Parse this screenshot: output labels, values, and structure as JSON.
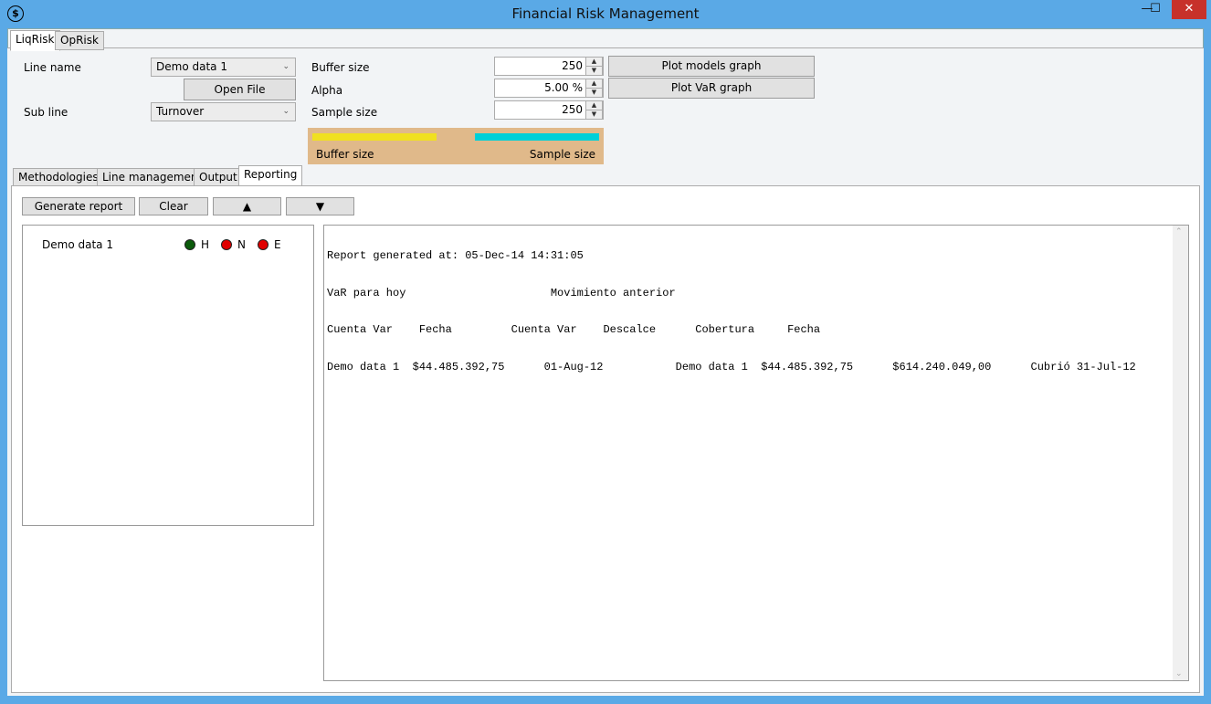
{
  "window": {
    "title": "Financial Risk Management",
    "min": "—",
    "max": "☐",
    "close": "✕",
    "app_icon": "dollar-icon",
    "app_icon_glyph": "$"
  },
  "top_tabs": [
    {
      "label": "LiqRisk"
    },
    {
      "label": "OpRisk"
    }
  ],
  "form": {
    "line_name_label": "Line name",
    "line_name_value": "Demo data 1",
    "open_file": "Open File",
    "sub_line_label": "Sub line",
    "sub_line_value": "Turnover",
    "buffer_size_label": "Buffer size",
    "buffer_size_value": "250",
    "alpha_label": "Alpha",
    "alpha_value": "5.00 %",
    "sample_size_label": "Sample size",
    "sample_size_value": "250",
    "plot_models": "Plot models graph",
    "plot_var": "Plot VaR graph"
  },
  "legend": {
    "buffer_label": "Buffer size",
    "sample_label": "Sample size",
    "buffer_color": "#f0e020",
    "sample_color": "#00d0d8"
  },
  "sub_tabs": [
    {
      "label": "Methodologies"
    },
    {
      "label": "Line management"
    },
    {
      "label": "Output"
    },
    {
      "label": "Reporting"
    }
  ],
  "toolbar": {
    "generate": "Generate report",
    "clear": "Clear",
    "up": "▲",
    "down": "▼"
  },
  "lines": [
    {
      "name": "Demo data 1",
      "indicators": [
        {
          "label": "H",
          "color": "#0a5a0a"
        },
        {
          "label": "N",
          "color": "#e00000"
        },
        {
          "label": "E",
          "color": "#e00000"
        }
      ]
    }
  ],
  "report": {
    "lines": [
      "Report generated at: 05-Dec-14 14:31:05",
      "VaR para hoy                      Movimiento anterior",
      "Cuenta Var    Fecha         Cuenta Var    Descalce      Cobertura     Fecha",
      "Demo data 1  $44.485.392,75      01-Aug-12           Demo data 1  $44.485.392,75      $614.240.049,00      Cubrió 31-Jul-12"
    ]
  }
}
